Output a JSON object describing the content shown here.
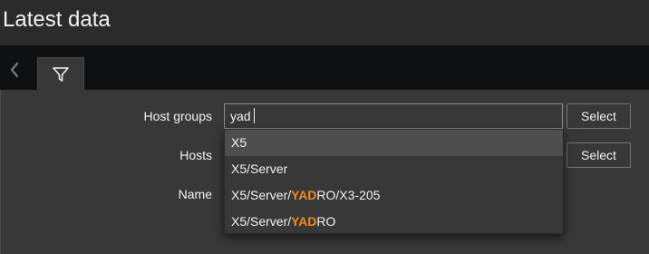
{
  "page": {
    "title": "Latest data"
  },
  "filter": {
    "host_groups_label": "Host groups",
    "host_groups_value": "yad",
    "hosts_label": "Hosts",
    "name_label": "Name",
    "select_label": "Select",
    "suggestions": [
      {
        "pre": "X5",
        "match": "",
        "post": ""
      },
      {
        "pre": "X5/Server",
        "match": "",
        "post": ""
      },
      {
        "pre": "X5/Server/",
        "match": "YAD",
        "post": "RO/X3-205"
      },
      {
        "pre": "X5/Server/",
        "match": "YAD",
        "post": "RO"
      }
    ]
  },
  "icons": {
    "collapse": "chevron-left-icon",
    "filter": "filter-icon"
  },
  "colors": {
    "highlight": "#f08b21",
    "background": "#2b2b2b",
    "panel": "#383838",
    "tabbar": "#0e1012"
  }
}
